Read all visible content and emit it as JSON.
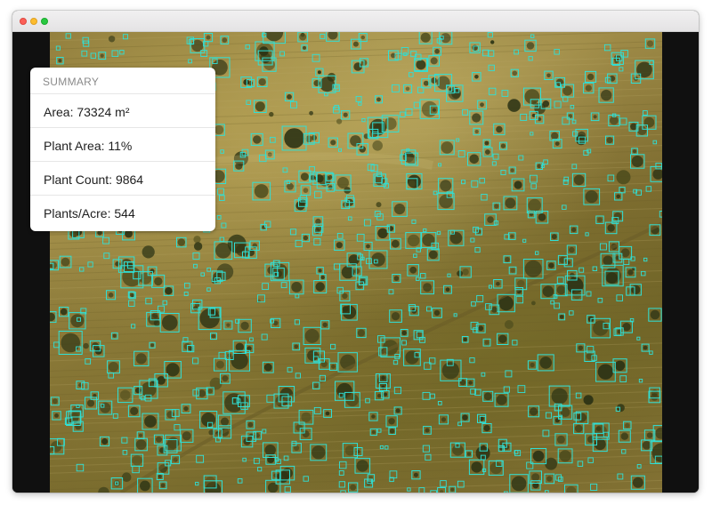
{
  "summary": {
    "header": "SUMMARY",
    "area": "Area: 73324 m²",
    "plant_area": "Plant Area: 11%",
    "plant_count": "Plant Count: 9864",
    "plants_per_acre": "Plants/Acre: 544"
  },
  "colors": {
    "detection_box": "#2fe0d6",
    "background": "#101010"
  }
}
